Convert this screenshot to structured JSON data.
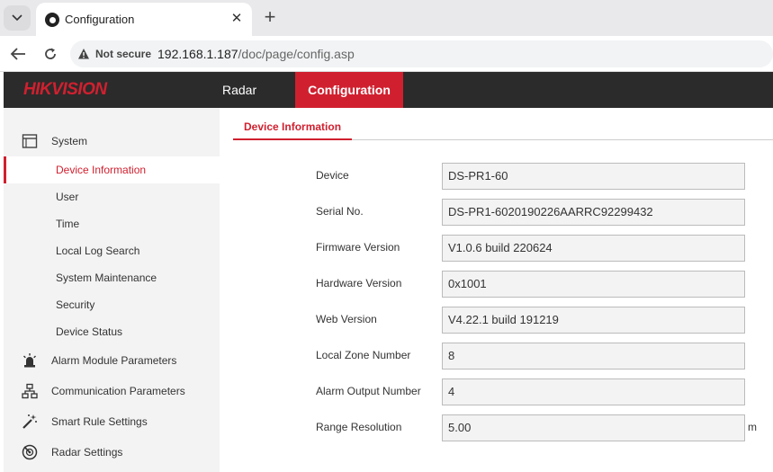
{
  "browser": {
    "tab_title": "Configuration",
    "close_glyph": "✕",
    "new_tab_glyph": "+",
    "security_label": "Not secure",
    "url_host": "192.168.1.187",
    "url_path": "/doc/page/config.asp"
  },
  "app": {
    "logo": "HIKVISION",
    "nav": {
      "radar": "Radar",
      "configuration": "Configuration"
    },
    "accent": "#d0202f"
  },
  "sidebar": {
    "system": {
      "label": "System",
      "items": [
        "Device Information",
        "User",
        "Time",
        "Local Log Search",
        "System Maintenance",
        "Security",
        "Device Status"
      ],
      "active": "Device Information"
    },
    "groups": [
      {
        "label": "Alarm Module Parameters",
        "icon": "alarm-icon"
      },
      {
        "label": "Communication Parameters",
        "icon": "network-icon"
      },
      {
        "label": "Smart Rule Settings",
        "icon": "wand-icon"
      },
      {
        "label": "Radar Settings",
        "icon": "radar-icon"
      }
    ]
  },
  "content": {
    "tab": "Device Information",
    "fields": [
      {
        "label": "Device",
        "value": "DS-PR1-60"
      },
      {
        "label": "Serial No.",
        "value": "DS-PR1-6020190226AARRC92299432"
      },
      {
        "label": "Firmware Version",
        "value": "V1.0.6 build 220624"
      },
      {
        "label": "Hardware Version",
        "value": "0x1001"
      },
      {
        "label": "Web Version",
        "value": "V4.22.1 build 191219"
      },
      {
        "label": "Local Zone Number",
        "value": "8"
      },
      {
        "label": "Alarm Output Number",
        "value": "4"
      },
      {
        "label": "Range Resolution",
        "value": "5.00",
        "unit": "m"
      }
    ]
  }
}
